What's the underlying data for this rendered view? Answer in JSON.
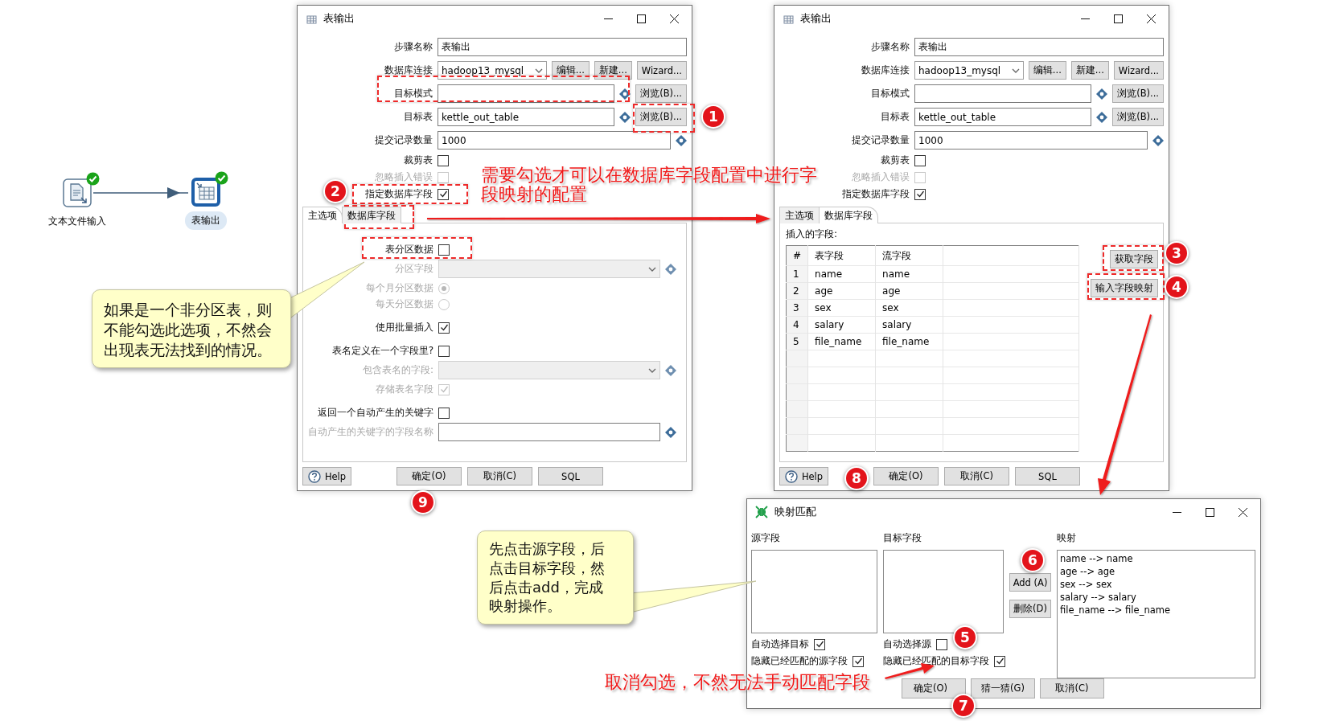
{
  "workflow": {
    "steps": [
      {
        "label": "文本文件输入",
        "kind": "file",
        "selected": false,
        "ok": true
      },
      {
        "label": "表输出",
        "kind": "table",
        "selected": true,
        "ok": true
      }
    ]
  },
  "dialogs": [
    {
      "title": "表输出",
      "fields": [
        {
          "kind": "text",
          "label": "步骤名称",
          "value": "表输出"
        },
        {
          "kind": "connection",
          "label": "数据库连接",
          "value": "hadoop13_mysql",
          "buttons": [
            "编辑...",
            "新建...",
            "Wizard..."
          ]
        },
        {
          "kind": "browse",
          "label": "目标模式",
          "button": "浏览(B)..."
        },
        {
          "kind": "browse",
          "label": "目标表",
          "value": "kettle_out_table",
          "button": "浏览(B)..."
        },
        {
          "kind": "variable",
          "label": "提交记录数量",
          "value": "1000"
        },
        {
          "kind": "check",
          "label": "裁剪表",
          "checked": false,
          "disabled": false
        },
        {
          "kind": "check",
          "label": "忽略插入错误",
          "checked": false,
          "disabled": true
        },
        {
          "kind": "check",
          "label": "指定数据库字段",
          "checked": true,
          "disabled": false
        }
      ],
      "tabs": [
        {
          "label": "主选项",
          "selected": true
        },
        {
          "label": "数据库字段",
          "selected": false
        }
      ],
      "panel": {
        "kind": "options",
        "groups": [
          [
            {
              "kind": "check",
              "label": "表分区数据",
              "checked": false,
              "disabled": false
            },
            {
              "kind": "select",
              "label": "分区字段",
              "disabled": true
            },
            {
              "kind": "radio",
              "label": "每个月分区数据",
              "selected": true,
              "disabled": true
            },
            {
              "kind": "radio",
              "label": "每天分区数据",
              "selected": false,
              "disabled": true
            }
          ],
          [
            {
              "kind": "check",
              "label": "使用批量插入",
              "checked": true,
              "disabled": false
            }
          ],
          [
            {
              "kind": "check",
              "label": "表名定义在一个字段里?",
              "checked": false,
              "disabled": false
            },
            {
              "kind": "select",
              "label": "包含表名的字段:",
              "disabled": true
            },
            {
              "kind": "check",
              "label": "存储表名字段",
              "checked": true,
              "disabled": true
            }
          ],
          [
            {
              "kind": "check",
              "label": "返回一个自动产生的关键字",
              "checked": false,
              "disabled": false
            },
            {
              "kind": "input",
              "label": "自动产生的关键字的字段名称",
              "disabled": true
            }
          ]
        ]
      },
      "buttons": [
        {
          "kind": "help",
          "label": "Help"
        },
        {
          "kind": "plain",
          "label": "确定(O)"
        },
        {
          "kind": "plain",
          "label": "取消(C)"
        },
        {
          "kind": "plain",
          "label": "SQL"
        }
      ]
    },
    {
      "title": "表输出",
      "fields": [
        {
          "kind": "text",
          "label": "步骤名称",
          "value": "表输出"
        },
        {
          "kind": "connection",
          "label": "数据库连接",
          "value": "hadoop13_mysql",
          "buttons": [
            "编辑...",
            "新建...",
            "Wizard..."
          ]
        },
        {
          "kind": "browse",
          "label": "目标模式",
          "button": "浏览(B)..."
        },
        {
          "kind": "browse",
          "label": "目标表",
          "value": "kettle_out_table",
          "button": "浏览(B)..."
        },
        {
          "kind": "variable",
          "label": "提交记录数量",
          "value": "1000"
        },
        {
          "kind": "check",
          "label": "裁剪表",
          "checked": false,
          "disabled": false
        },
        {
          "kind": "check",
          "label": "忽略插入错误",
          "checked": false,
          "disabled": true
        },
        {
          "kind": "check",
          "label": "指定数据库字段",
          "checked": true,
          "disabled": false
        }
      ],
      "tabs": [
        {
          "label": "主选项",
          "selected": false
        },
        {
          "label": "数据库字段",
          "selected": true
        }
      ],
      "panel": {
        "kind": "fields",
        "label": "插入的字段:",
        "columns": [
          "#",
          "表字段",
          "流字段"
        ],
        "rows": [
          [
            "1",
            "name",
            "name"
          ],
          [
            "2",
            "age",
            "age"
          ],
          [
            "3",
            "sex",
            "sex"
          ],
          [
            "4",
            "salary",
            "salary"
          ],
          [
            "5",
            "file_name",
            "file_name"
          ]
        ],
        "actions": [
          "获取字段",
          "输入字段映射"
        ]
      },
      "buttons": [
        {
          "kind": "help",
          "label": "Help"
        },
        {
          "kind": "plain",
          "label": "确定(O)"
        },
        {
          "kind": "plain",
          "label": "取消(C)"
        },
        {
          "kind": "plain",
          "label": "SQL"
        }
      ]
    }
  ],
  "mapping_dialog": {
    "title": "映射匹配",
    "source_label": "源字段",
    "target_label": "目标字段",
    "mapping_label": "映射",
    "mappings": [
      "name --> name",
      "age --> age",
      "sex --> sex",
      "salary --> salary",
      "file_name --> file_name"
    ],
    "actions": [
      "Add (A)",
      "删除(D)"
    ],
    "source_options": [
      {
        "label": "自动选择目标",
        "checked": true
      },
      {
        "label": "隐藏已经匹配的源字段",
        "checked": true
      }
    ],
    "target_options": [
      {
        "label": "自动选择源",
        "checked": false
      },
      {
        "label": "隐藏已经匹配的目标字段",
        "checked": true
      }
    ],
    "buttons": [
      "确定(O)",
      "猜一猜(G)",
      "取消(C)"
    ]
  },
  "callouts": [
    "如果是一个非分区表，则不能勾选此选项，不然会出现表无法找到的情况。",
    "先点击源字段，后点击目标字段，然后点击add，完成映射操作。"
  ],
  "notes": [
    "需要勾选才可以在数据库字段配置中进行字段映射的配置",
    "取消勾选，不然无法手动匹配字段"
  ],
  "markers": [
    "1",
    "2",
    "3",
    "4",
    "5",
    "6",
    "7",
    "8",
    "9"
  ]
}
